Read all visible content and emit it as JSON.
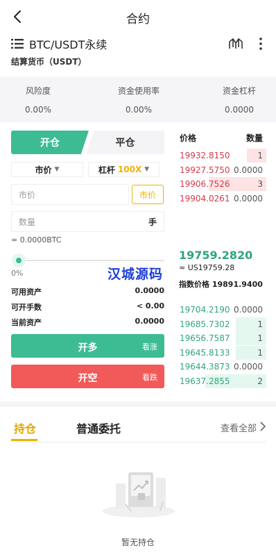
{
  "header": {
    "title": "合约"
  },
  "pair": {
    "name": "BTC/USDT永续",
    "settle_label": "结算货币（USDT）"
  },
  "stats": [
    {
      "label": "风险度",
      "value": "0.00%"
    },
    {
      "label": "资金使用率",
      "value": "0.00%"
    },
    {
      "label": "资金杠杆",
      "value": "0.0000"
    }
  ],
  "trade": {
    "tab_open": "开仓",
    "tab_close": "平仓",
    "order_type": "市价",
    "leverage_label": "杠杆",
    "leverage_value": "100X",
    "price_placeholder": "市价",
    "market_button": "市价",
    "qty_placeholder": "数量",
    "qty_unit": "手",
    "equiv": "= 0.0000BTC",
    "slider_percent_label": "0%",
    "slider_value": 0,
    "available_label": "可用资产",
    "available_value": "0.0000",
    "openable_label": "可开手数",
    "openable_value": "< 0.00",
    "current_label": "当前资产",
    "current_value": "0.0000",
    "long_label": "开多",
    "long_sub": "看涨",
    "short_label": "开空",
    "short_sub": "看跌"
  },
  "orderbook": {
    "price_header": "价格",
    "qty_header": "数量",
    "asks": [
      {
        "price": "19932.8150",
        "qty": "1",
        "depth": 0.22
      },
      {
        "price": "19927.5750",
        "qty": "0.0000",
        "depth": 0
      },
      {
        "price": "19906.7526",
        "qty": "3",
        "depth": 0.66
      },
      {
        "price": "19904.0261",
        "qty": "0.0000",
        "depth": 0
      }
    ],
    "last_price": "19759.2820",
    "approx": "≈ US19759.28",
    "index_label": "指数价格",
    "index_value": "19891.9400",
    "bids": [
      {
        "price": "19704.2190",
        "qty": "0.0000",
        "depth": 0
      },
      {
        "price": "19685.7302",
        "qty": "1",
        "depth": 0.35
      },
      {
        "price": "19656.7587",
        "qty": "1",
        "depth": 0.35
      },
      {
        "price": "19645.8133",
        "qty": "1",
        "depth": 0.35
      },
      {
        "price": "19644.3873",
        "qty": "0.0000",
        "depth": 0
      },
      {
        "price": "19637.2855",
        "qty": "2",
        "depth": 0.7
      }
    ]
  },
  "watermark": "汉城源码",
  "positions": {
    "tab_holding": "持仓",
    "tab_orders": "普通委托",
    "see_all": "查看全部",
    "empty_text": "暂无持仓"
  }
}
